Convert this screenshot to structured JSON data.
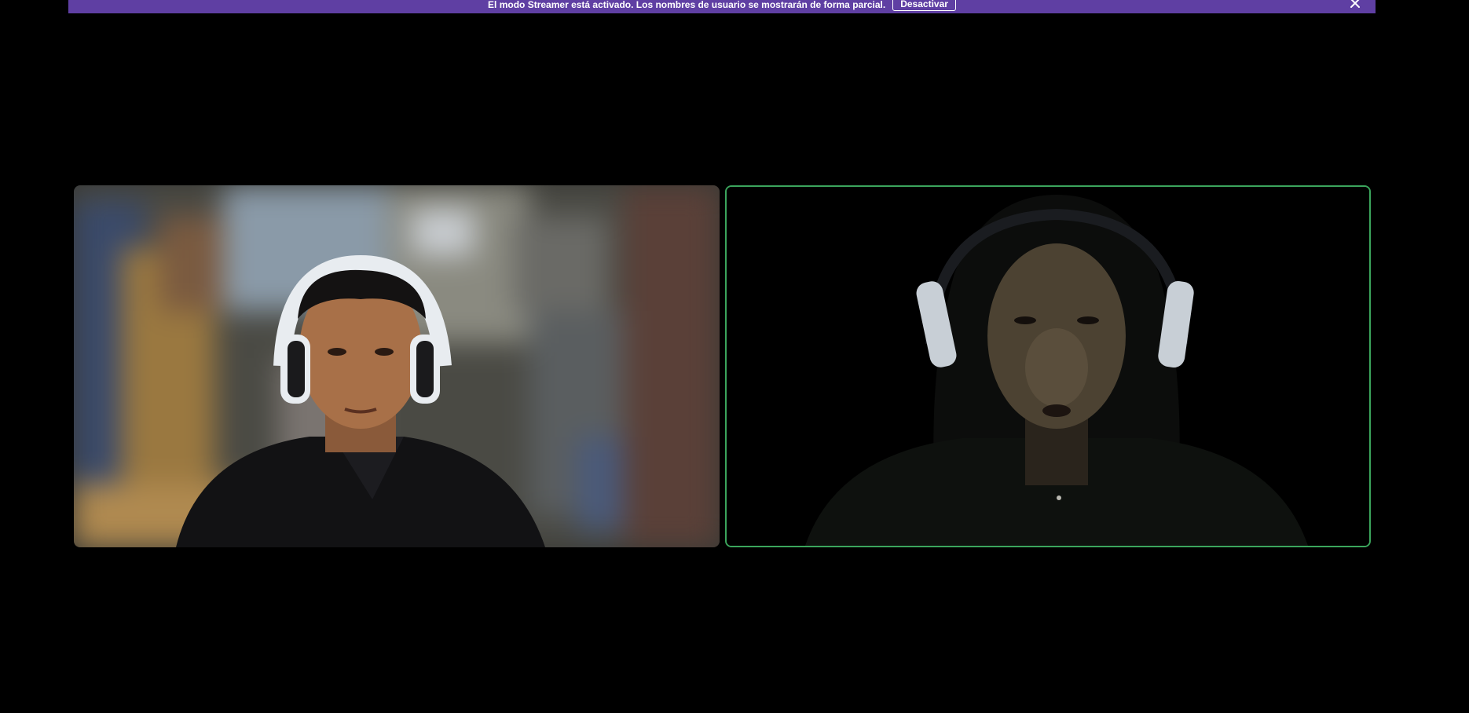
{
  "banner": {
    "message": "El modo Streamer está activado. Los nombres de usuario se mostrarán de forma parcial.",
    "action_label": "Desactivar",
    "close_icon": "close-icon",
    "color": "#5f3fa3"
  },
  "call": {
    "participants": [
      {
        "tile": "video-tile-left",
        "speaking": false
      },
      {
        "tile": "video-tile-right",
        "speaking": true,
        "speaking_border_color": "#3ba55c"
      }
    ]
  }
}
